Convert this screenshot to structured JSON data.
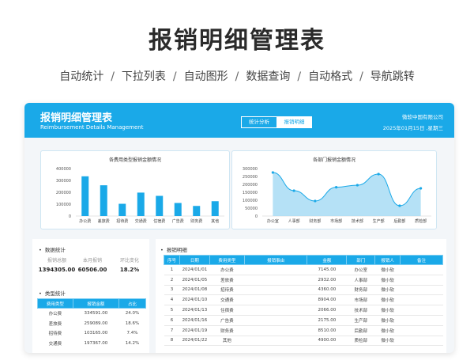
{
  "promo": {
    "title": "报销明细管理表",
    "features": [
      "自动统计",
      "下拉列表",
      "自动图形",
      "数据查询",
      "自动格式",
      "导航跳转"
    ]
  },
  "header": {
    "title": "报销明细管理表",
    "subtitle": "Reimbursement Details Management",
    "tabs": [
      "统计分析",
      "报销明细"
    ],
    "active_tab": "报销明细",
    "company": "微软中国有限公司",
    "date": "2025年01月15日 ,星期三"
  },
  "colors": {
    "accent": "#1aa9e8",
    "area_fill": "#a8dcf5"
  },
  "charts": {
    "bar_title": "各费用类型报销金额情况",
    "area_title": "各部门报销金额情况"
  },
  "chart_data": [
    {
      "type": "bar",
      "title": "各费用类型报销金额情况",
      "categories": [
        "办公费",
        "差旅费",
        "招待费",
        "交通费",
        "住宿费",
        "广告费",
        "财务费",
        "其他"
      ],
      "values": [
        334591,
        259089,
        103165,
        197367,
        170000,
        110000,
        85000,
        125000
      ],
      "ylim": [
        0,
        400000
      ],
      "yticks": [
        "0",
        "100000",
        "200000",
        "300000",
        "400000"
      ]
    },
    {
      "type": "area",
      "title": "各部门报销金额情况",
      "categories": [
        "办公室",
        "人事部",
        "财务部",
        "市场部",
        "技术部",
        "生产部",
        "后勤部",
        "质检部"
      ],
      "values": [
        275000,
        160000,
        95000,
        182000,
        195000,
        265000,
        65000,
        175000
      ],
      "ylim": [
        0,
        300000
      ],
      "yticks": [
        "0",
        "50000",
        "100000",
        "150000",
        "200000",
        "250000",
        "300000"
      ]
    }
  ],
  "stats": {
    "section_title": "数据统计",
    "labels": [
      "报销总额",
      "本月报销",
      "环比变化"
    ],
    "values": [
      "1394305.00",
      "60506.00",
      "18.2%"
    ]
  },
  "type_stats": {
    "section_title": "类型统计",
    "headers": [
      "费用类型",
      "报销金额",
      "占比"
    ],
    "rows": [
      [
        "办公费",
        "334591.00",
        "24.0%"
      ],
      [
        "差旅费",
        "259089.00",
        "18.6%"
      ],
      [
        "招待费",
        "103165.00",
        "7.4%"
      ],
      [
        "交通费",
        "197367.00",
        "14.2%"
      ]
    ]
  },
  "details": {
    "section_title": "报销明细",
    "headers": [
      "序号",
      "日期",
      "费用类型",
      "报销事由",
      "金额",
      "部门",
      "报销人",
      "备注"
    ],
    "rows": [
      [
        "1",
        "2024/01/01",
        "办公费",
        "",
        "7145.00",
        "办公室",
        "微小软",
        ""
      ],
      [
        "2",
        "2024/01/05",
        "差旅费",
        "",
        "2932.00",
        "人事部",
        "微小软",
        ""
      ],
      [
        "3",
        "2024/01/08",
        "招待费",
        "",
        "4360.00",
        "财务部",
        "微小软",
        ""
      ],
      [
        "4",
        "2024/01/10",
        "交通费",
        "",
        "8904.00",
        "市场部",
        "微小软",
        ""
      ],
      [
        "5",
        "2024/01/13",
        "住宿费",
        "",
        "2066.00",
        "技术部",
        "微小软",
        ""
      ],
      [
        "6",
        "2024/01/16",
        "广告费",
        "",
        "2175.00",
        "生产部",
        "微小软",
        ""
      ],
      [
        "7",
        "2024/01/19",
        "财务费",
        "",
        "8510.00",
        "后勤部",
        "微小软",
        ""
      ],
      [
        "8",
        "2024/01/22",
        "其他",
        "",
        "4900.00",
        "质检部",
        "微小软",
        ""
      ]
    ]
  }
}
